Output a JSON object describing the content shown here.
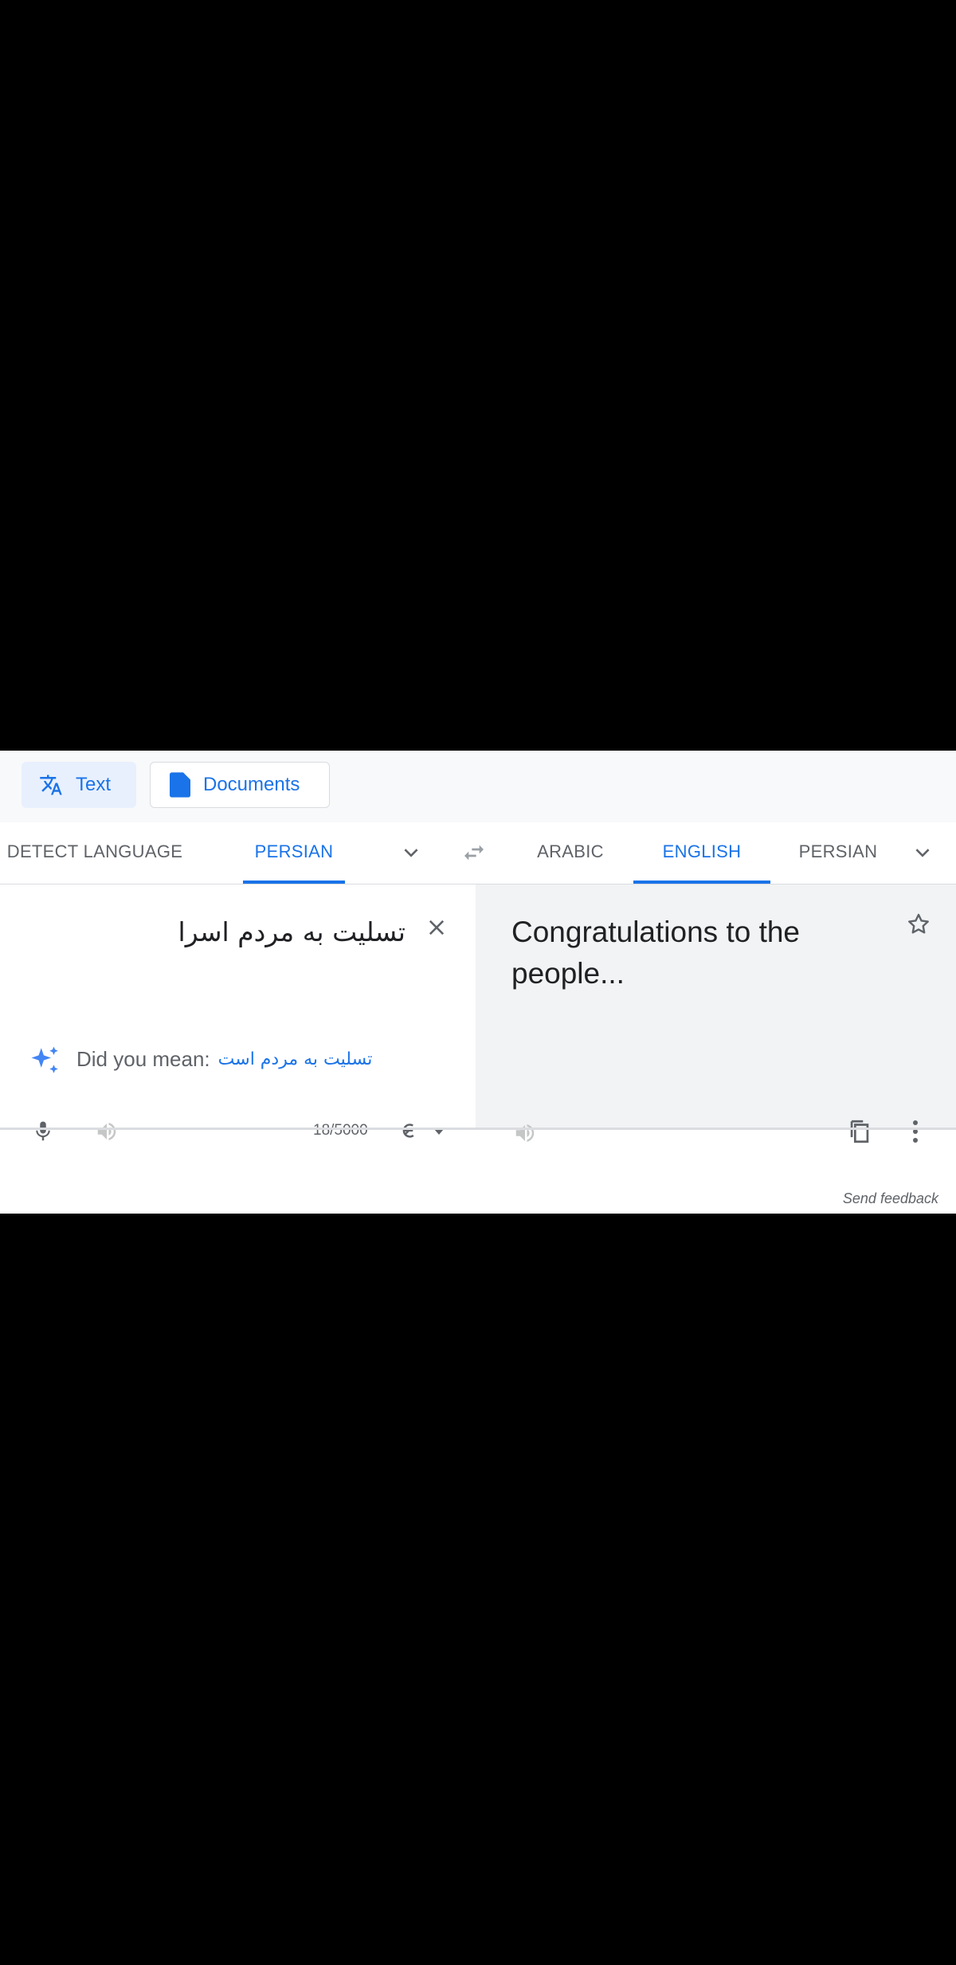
{
  "modes": {
    "text": "Text",
    "documents": "Documents"
  },
  "source_langs": {
    "detect": "DETECT LANGUAGE",
    "active": "PERSIAN"
  },
  "target_langs": {
    "first": "ARABIC",
    "active": "ENGLISH",
    "third": "PERSIAN"
  },
  "source": {
    "text": "تسلیت به مردم اسرا",
    "did_you_mean_label": "Did you mean:",
    "suggestion": "تسلیت به مردم است",
    "char_count": "18/5000"
  },
  "target": {
    "text": "Congratulations to the people..."
  },
  "footer": {
    "send_feedback": "Send feedback"
  },
  "colors": {
    "accent": "#1a73e8",
    "icon_gray": "#5f6368",
    "target_bg": "#f1f3f4"
  }
}
